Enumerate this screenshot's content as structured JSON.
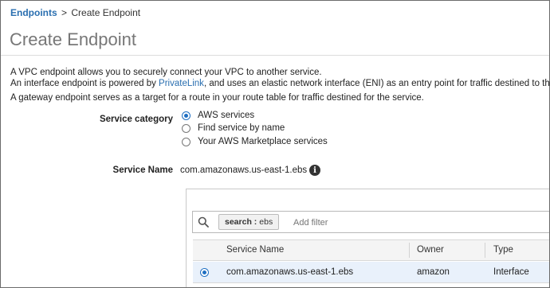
{
  "breadcrumb": {
    "parent_label": "Endpoints",
    "separator": ">",
    "current_label": "Create Endpoint"
  },
  "page": {
    "title": "Create Endpoint"
  },
  "description": {
    "line1": "A VPC endpoint allows you to securely connect your VPC to another service.",
    "line2_before": "An interface endpoint is powered by",
    "line2_link": "PrivateLink",
    "line2_after": ", and uses an elastic network interface (ENI) as an entry point for traffic destined to the s",
    "line3": "A gateway endpoint serves as a target for a route in your route table for traffic destined for the service."
  },
  "service_category": {
    "label": "Service category",
    "options": [
      {
        "label": "AWS services",
        "selected": true
      },
      {
        "label": "Find service by name",
        "selected": false
      },
      {
        "label": "Your AWS Marketplace services",
        "selected": false
      }
    ]
  },
  "service_name": {
    "label": "Service Name",
    "value": "com.amazonaws.us-east-1.ebs",
    "info_icon": "info-icon"
  },
  "search": {
    "icon": "search-icon",
    "filter_chip": {
      "key": "search :",
      "value": "ebs"
    },
    "placeholder": "Add filter"
  },
  "table": {
    "columns": [
      "Service Name",
      "Owner",
      "Type"
    ],
    "rows": [
      {
        "selected": true,
        "service_name": "com.amazonaws.us-east-1.ebs",
        "owner": "amazon",
        "type": "Interface"
      }
    ]
  },
  "colors": {
    "link": "#2a6fb0",
    "radio_selected": "#1f6fc2",
    "selected_row": "#e9f1fb",
    "title_gray": "#777777"
  }
}
